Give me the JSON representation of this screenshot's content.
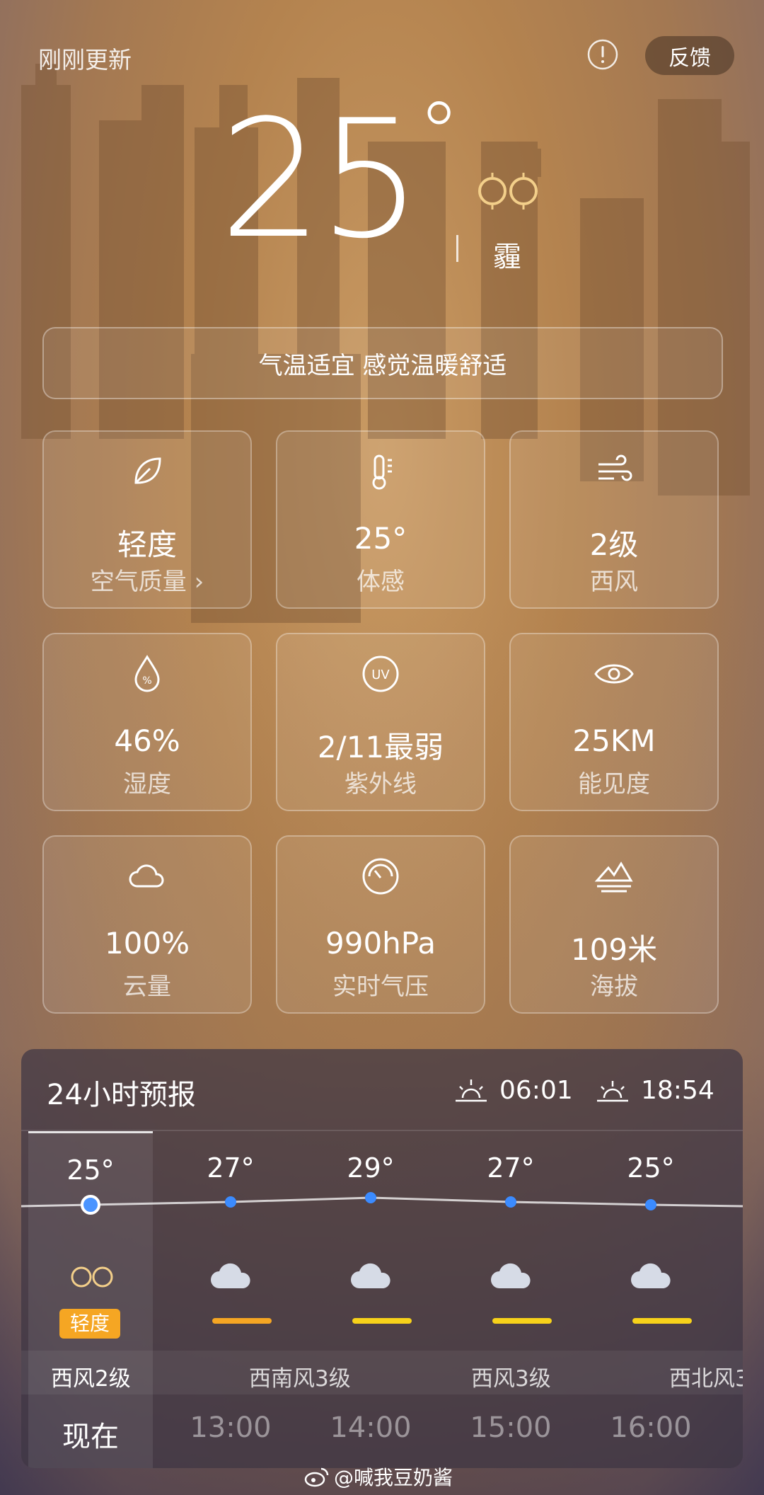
{
  "header": {
    "update_status": "刚刚更新",
    "feedback_label": "反馈"
  },
  "current": {
    "temperature": "25",
    "degree": "°",
    "condition": "霾"
  },
  "tip": "气温适宜 感觉温暖舒适",
  "cards": [
    {
      "icon": "leaf-icon",
      "value": "轻度",
      "label": "空气质量 ›"
    },
    {
      "icon": "thermometer-icon",
      "value": "25°",
      "label": "体感"
    },
    {
      "icon": "wind-icon",
      "value": "2级",
      "label": "西风"
    },
    {
      "icon": "humidity-drop-icon",
      "value": "46%",
      "label": "湿度"
    },
    {
      "icon": "uv-icon",
      "value": "2/11最弱",
      "label": "紫外线"
    },
    {
      "icon": "eye-icon",
      "value": "25KM",
      "label": "能见度"
    },
    {
      "icon": "cloud-icon",
      "value": "100%",
      "label": "云量"
    },
    {
      "icon": "gauge-icon",
      "value": "990hPa",
      "label": "实时气压"
    },
    {
      "icon": "mountain-icon",
      "value": "109米",
      "label": "海拔"
    }
  ],
  "forecast": {
    "title": "24小时预报",
    "sunrise": "06:01",
    "sunset": "18:54",
    "hours": [
      {
        "temp": "25°",
        "time": "现在",
        "icon": "haze-icon",
        "aqi": "轻度"
      },
      {
        "temp": "27°",
        "time": "13:00",
        "icon": "cloudy-icon",
        "bar_color": "#f5a623"
      },
      {
        "temp": "29°",
        "time": "14:00",
        "icon": "cloudy-icon",
        "bar_color": "#f7d21a"
      },
      {
        "temp": "27°",
        "time": "15:00",
        "icon": "cloudy-icon",
        "bar_color": "#f7d21a"
      },
      {
        "temp": "25°",
        "time": "16:00",
        "icon": "cloudy-icon",
        "bar_color": "#f7d21a"
      }
    ],
    "winds": [
      "西风2级",
      "西南风3级",
      "西风3级",
      "西北风3"
    ]
  },
  "watermark": "@喊我豆奶酱",
  "colors": {
    "accent_dot": "#3b8bff",
    "aqi_badge": "#f5a623"
  }
}
